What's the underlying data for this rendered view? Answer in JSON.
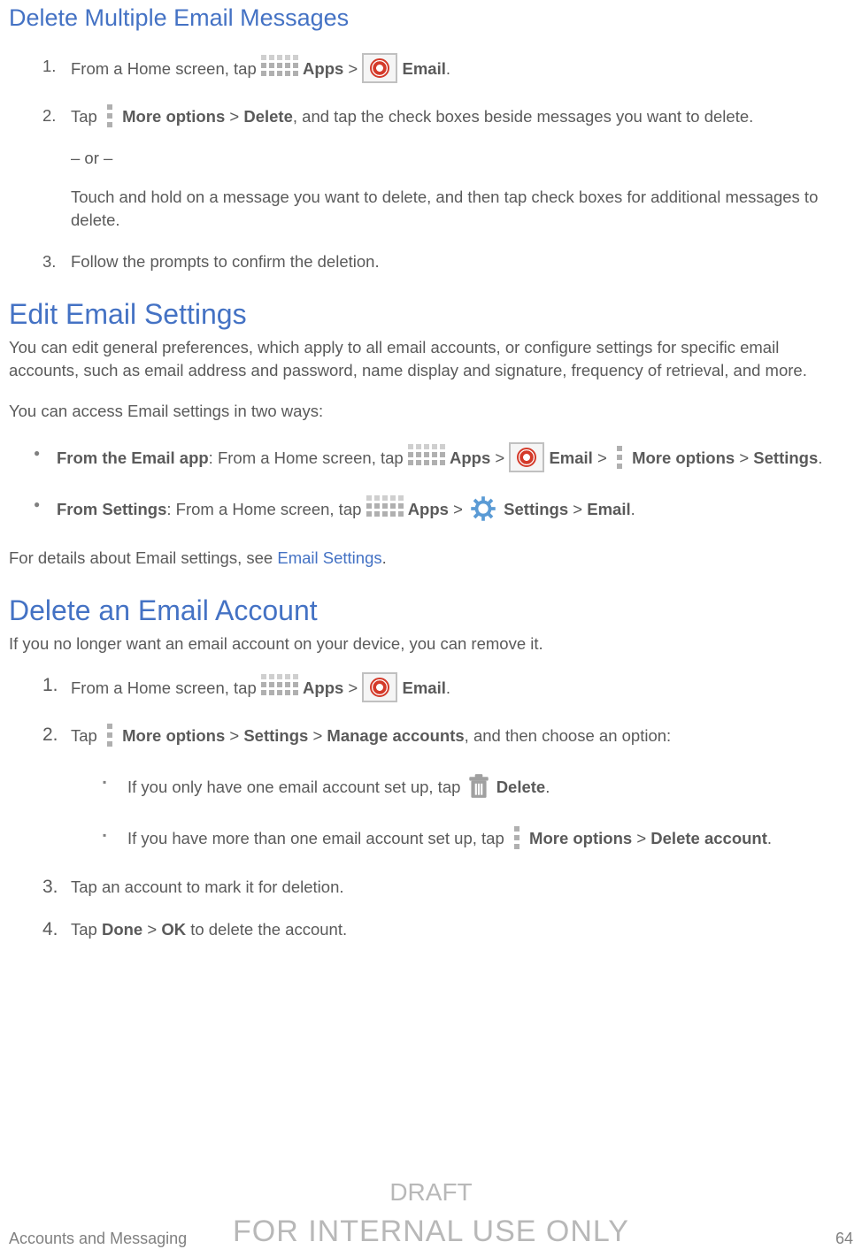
{
  "h_delete_multi": "Delete Multiple Email Messages",
  "h_edit": "Edit Email Settings",
  "h_delete_account": "Delete an Email Account",
  "edit_intro": "You can edit general preferences, which apply to all email accounts, or configure settings for specific email accounts, such as email address and password, name display and signature, frequency of retrieval, and more.",
  "edit_access_intro": "You can access Email settings in two ways:",
  "delete_account_intro": "If you no longer want an email account on your device, you can remove it.",
  "detail_prefix": "For details about Email settings, see ",
  "detail_link": "Email Settings",
  "detail_suffix": ".",
  "txt": {
    "from_home_tap": "From a Home screen, tap ",
    "apps": "Apps",
    "email": "Email",
    "tap": "Tap ",
    "more_options": "More options",
    "delete": "Delete",
    "step1_suffix": ", and tap the check boxes beside messages you want to delete.",
    "or": "– or –",
    "step1_alt": "Touch and hold on a message you want to delete, and then tap check boxes for additional messages to delete.",
    "step3": "Follow the prompts to confirm the deletion.",
    "from_email_app": "From the Email app",
    "colon_from_home_tap": ": From a Home screen, tap ",
    "settings": "Settings",
    "from_settings": "From Settings",
    "manage_accounts": "Manage accounts",
    "then_choose": ", and then choose an option:",
    "only_one": "If you only have one email account set up, tap ",
    "more_than_one": "If you have more than one email account set up, tap ",
    "delete_account": "Delete account",
    "step3b": "Tap an account to mark it for deletion.",
    "done": "Done",
    "ok": "OK",
    "to_delete_account": " to delete the account."
  },
  "footer": {
    "left": "Accounts and Messaging",
    "page": "64"
  },
  "watermark": {
    "line1": "DRAFT",
    "line2": "FOR INTERNAL USE ONLY"
  }
}
